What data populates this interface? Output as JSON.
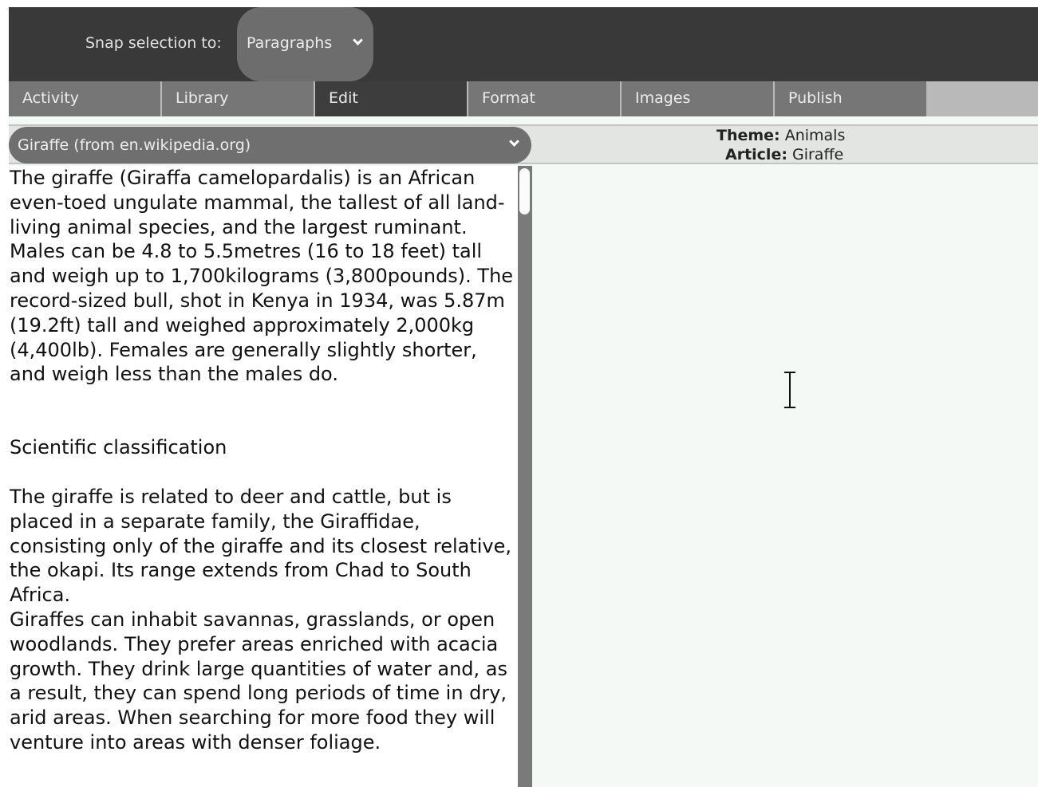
{
  "toolbar": {
    "snap_label": "Snap selection to:",
    "snap_value": "Paragraphs"
  },
  "tabs": [
    {
      "label": "Activity",
      "active": false
    },
    {
      "label": "Library",
      "active": false
    },
    {
      "label": "Edit",
      "active": true
    },
    {
      "label": "Format",
      "active": false
    },
    {
      "label": "Images",
      "active": false
    },
    {
      "label": "Publish",
      "active": false
    }
  ],
  "article_selector": {
    "value": "Giraffe (from en.wikipedia.org)"
  },
  "meta": {
    "theme_key": "Theme:",
    "theme_value": "Animals",
    "article_key": "Article:",
    "article_value": "Giraffe"
  },
  "article": {
    "intro": "The giraffe (Giraffa camelopardalis) is an African even-toed ungulate mammal, the tallest of all land-living animal species, and the largest ruminant. Males can be 4.8 to 5.5metres (16 to 18 feet) tall and weigh up to 1,700kilograms (3,800pounds). The record-sized bull, shot in Kenya in 1934, was 5.87m (19.2ft) tall and weighed approximately 2,000kg (4,400lb). Females are generally slightly shorter, and weigh less than the males do.",
    "heading": "Scientific classification",
    "para1": "The giraffe is related to deer and cattle, but is placed in a separate family, the Giraffidae, consisting only of the giraffe and its closest relative, the okapi. Its range extends from Chad to South Africa.",
    "para2": "Giraffes can inhabit savannas, grasslands, or open woodlands. They prefer areas enriched with acacia growth. They drink large quantities of water and, as a result, they can spend long periods of time in dry, arid areas. When searching for more food they will venture into areas with denser foliage."
  },
  "colors": {
    "toolbar_bg": "#393939",
    "tab_bg": "#767676",
    "tab_active_bg": "#3d3d3d",
    "pane_bg": "#f5f9f5"
  }
}
